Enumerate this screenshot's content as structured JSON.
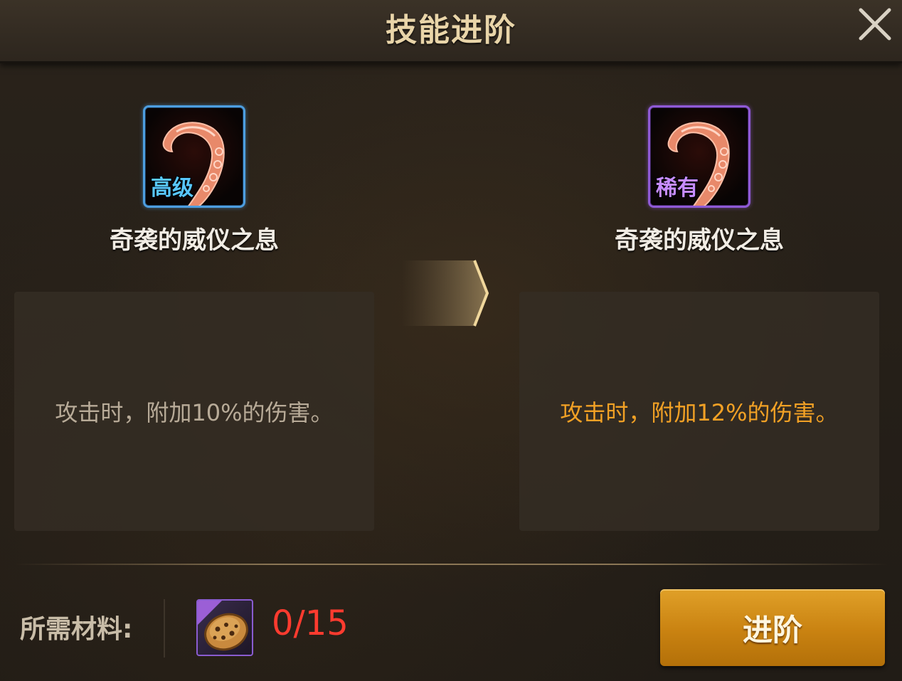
{
  "header": {
    "title": "技能进阶",
    "close_icon": "close-icon"
  },
  "current_skill": {
    "grade": "高级",
    "grade_color": "#58c7ff",
    "frame_color": "#4d9ee0",
    "name": "奇袭的威仪之息",
    "description": "攻击时，附加10%的伤害。",
    "icon": "tentacle-skill-icon"
  },
  "next_skill": {
    "grade": "稀有",
    "grade_color": "#c68cff",
    "frame_color": "#8f5ad6",
    "name": "奇袭的威仪之息",
    "description": "攻击时，附加12%的伤害。",
    "description_color": "#f2a125",
    "icon": "tentacle-skill-icon"
  },
  "arrow_icon": "chevron-right-icon",
  "materials": {
    "label": "所需材料:",
    "item_icon": "cookie-material-icon",
    "count": "0/15",
    "count_color": "#ff3b2f"
  },
  "advance_button": {
    "label": "进阶",
    "color": "#c98211"
  }
}
